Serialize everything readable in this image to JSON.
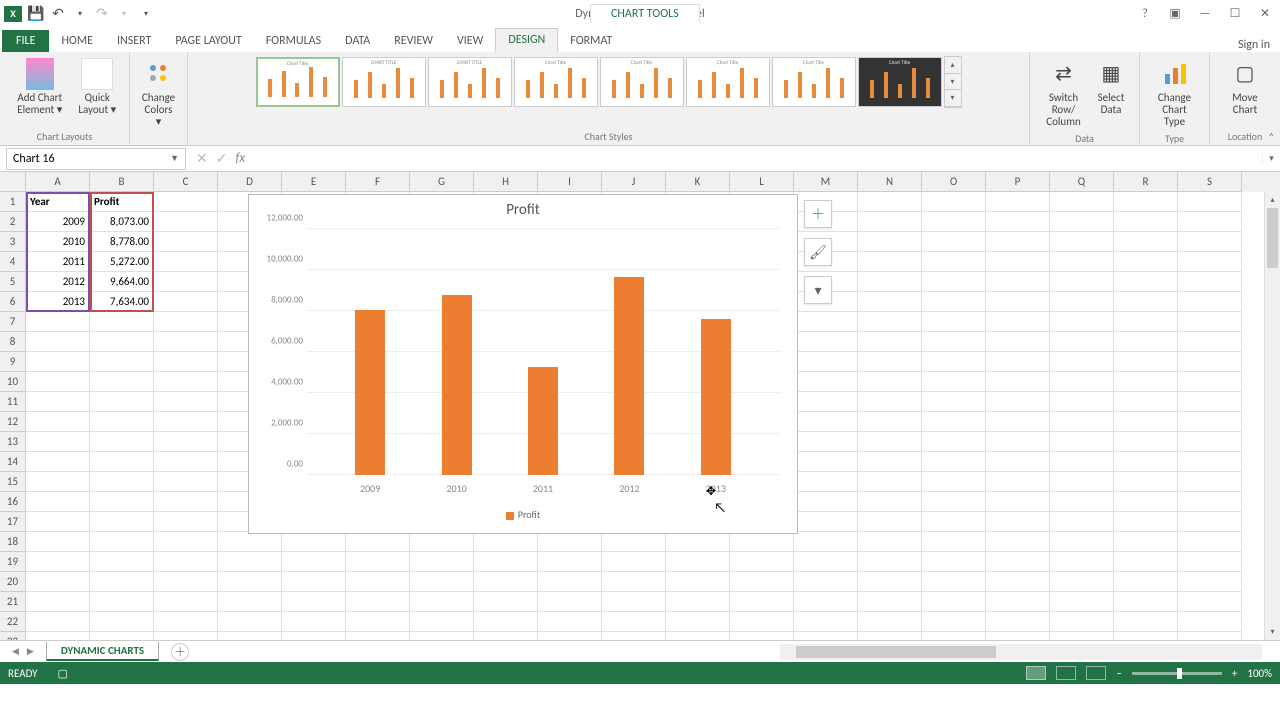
{
  "titlebar": {
    "filename": "Dynamic charts.xlsx - Excel",
    "chart_tools": "CHART TOOLS"
  },
  "tabs": {
    "file": "FILE",
    "home": "HOME",
    "insert": "INSERT",
    "page_layout": "PAGE LAYOUT",
    "formulas": "FORMULAS",
    "data": "DATA",
    "review": "REVIEW",
    "view": "VIEW",
    "design": "DESIGN",
    "format": "FORMAT",
    "signin": "Sign in"
  },
  "ribbon": {
    "add_chart_element": "Add Chart Element ▾",
    "quick_layout": "Quick Layout ▾",
    "change_colors": "Change Colors ▾",
    "switch_row_col": "Switch Row/\nColumn",
    "select_data": "Select\nData",
    "change_chart_type": "Change\nChart Type",
    "move_chart": "Move\nChart",
    "group_layouts": "Chart Layouts",
    "group_styles": "Chart Styles",
    "group_data": "Data",
    "group_type": "Type",
    "group_location": "Location"
  },
  "namebox": "Chart 16",
  "sheet": {
    "columns": [
      "A",
      "B",
      "C",
      "D",
      "E",
      "F",
      "G",
      "H",
      "I",
      "J",
      "K",
      "L",
      "M",
      "N",
      "O",
      "P",
      "Q",
      "R",
      "S"
    ],
    "header_year": "Year",
    "header_profit": "Profit",
    "rows": [
      {
        "year": "2009",
        "profit": "8,073.00"
      },
      {
        "year": "2010",
        "profit": "8,778.00"
      },
      {
        "year": "2011",
        "profit": "5,272.00"
      },
      {
        "year": "2012",
        "profit": "9,664.00"
      },
      {
        "year": "2013",
        "profit": "7,634.00"
      }
    ]
  },
  "chart_data": {
    "type": "bar",
    "title": "Profit",
    "categories": [
      "2009",
      "2010",
      "2011",
      "2012",
      "2013"
    ],
    "series": [
      {
        "name": "Profit",
        "values": [
          8073,
          8778,
          5272,
          9664,
          7634
        ]
      }
    ],
    "ylim": [
      0,
      12000
    ],
    "ytick_labels": [
      "0.00",
      "2,000.00",
      "4,000.00",
      "6,000.00",
      "8,000.00",
      "10,000.00",
      "12,000.00"
    ],
    "legend": "Profit"
  },
  "sheettab": "DYNAMIC CHARTS",
  "status": {
    "ready": "READY",
    "zoom": "100%"
  }
}
